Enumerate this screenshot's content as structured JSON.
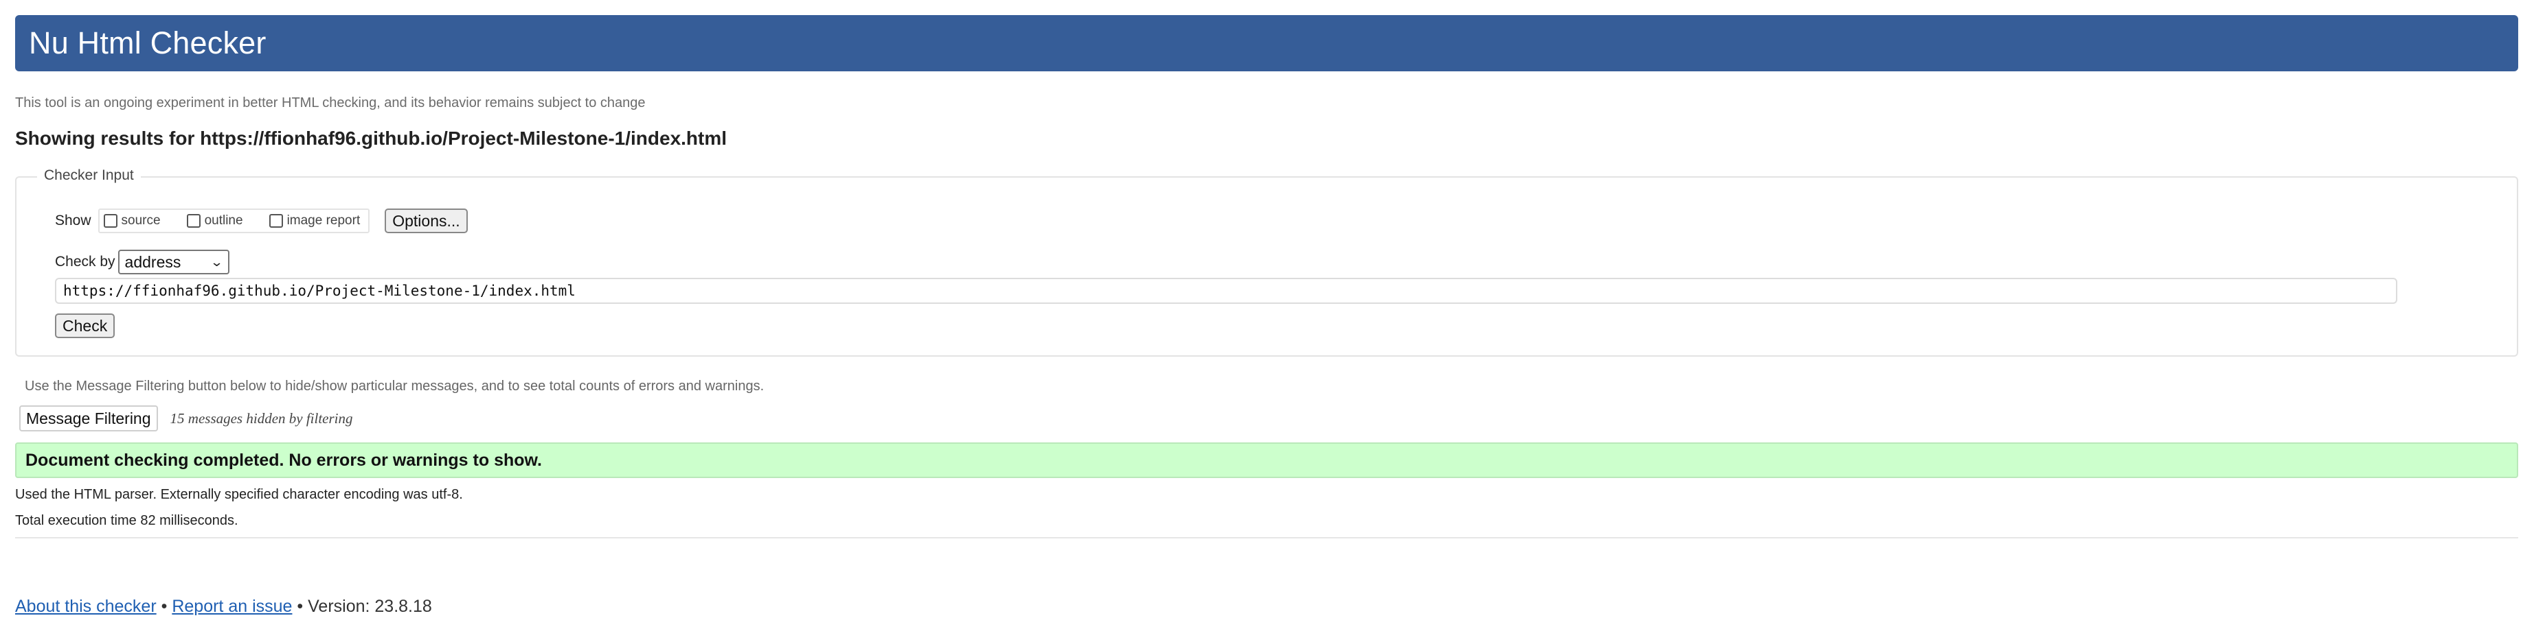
{
  "header": {
    "title": "Nu Html Checker"
  },
  "subtitle": "This tool is an ongoing experiment in better HTML checking, and its behavior remains subject to change",
  "results_heading": "Showing results for https://ffionhaf96.github.io/Project-Milestone-1/index.html",
  "checker_input": {
    "legend": "Checker Input",
    "show_label": "Show",
    "options": [
      {
        "label": "source",
        "checked": false
      },
      {
        "label": "outline",
        "checked": false
      },
      {
        "label": "image report",
        "checked": false
      }
    ],
    "options_button": "Options...",
    "check_by_label": "Check by",
    "check_by_value": "address",
    "url_value": "https://ffionhaf96.github.io/Project-Milestone-1/index.html",
    "check_button": "Check"
  },
  "filtering": {
    "hint": "Use the Message Filtering button below to hide/show particular messages, and to see total counts of errors and warnings.",
    "button": "Message Filtering",
    "hidden_count": "15 messages hidden by filtering"
  },
  "result": {
    "message": "Document checking completed. No errors or warnings to show.",
    "parser_info": "Used the HTML parser. Externally specified character encoding was utf-8.",
    "timing_info": "Total execution time 82 milliseconds."
  },
  "footer": {
    "about_link": "About this checker",
    "separator": "•",
    "report_link": "Report an issue",
    "version": "Version: 23.8.18"
  },
  "colors": {
    "header_bg": "#365d98",
    "success_bg": "#ccffcc",
    "link": "#1f5fb2"
  }
}
